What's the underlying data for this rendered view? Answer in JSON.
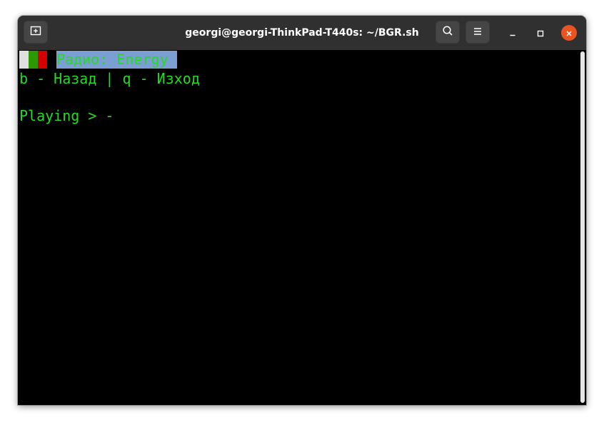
{
  "window": {
    "title": "georgi@georgi-ThinkPad-T440s: ~/BGR.sh"
  },
  "icons": {
    "new_tab": "new-tab-icon",
    "search": "search-icon",
    "menu": "hamburger-menu-icon",
    "minimize": "minimize-icon",
    "maximize": "maximize-icon",
    "close": "close-icon"
  },
  "colors": {
    "terminal_text": "#26d926",
    "terminal_bg": "#000000",
    "title_highlight": "#7b9fd2",
    "close_button": "#e95420",
    "flag": [
      "#e0e0e0",
      "#2b9a00",
      "#d40000"
    ]
  },
  "terminal": {
    "header_title": "Радио: Energy",
    "help_line": "b - Назад | q - Изход",
    "status_line": "Playing > -"
  }
}
